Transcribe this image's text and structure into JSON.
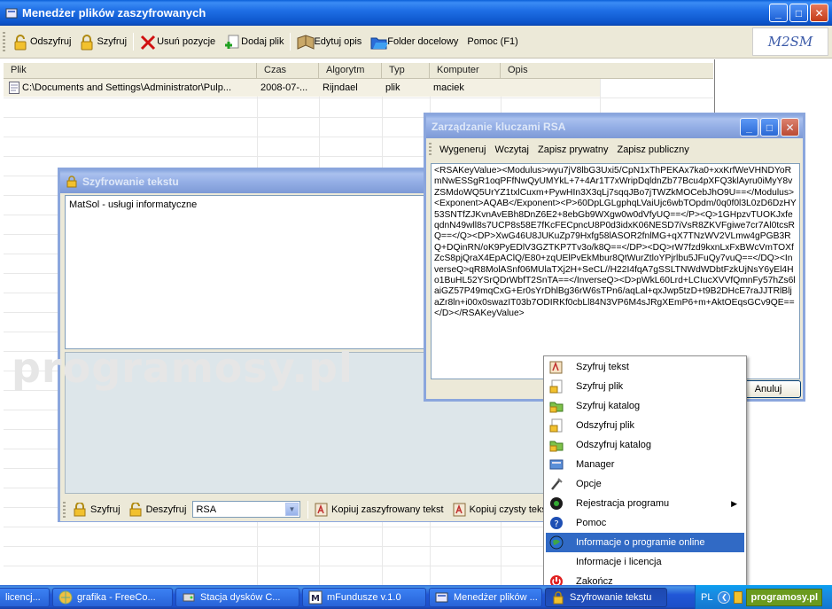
{
  "main_window": {
    "title": "Menedżer plików zaszyfrowanych",
    "toolbar": [
      {
        "label": "Odszyfruj",
        "icon": "padlock-open-icon"
      },
      {
        "label": "Szyfruj",
        "icon": "padlock-icon"
      },
      {
        "label": "Usuń pozycje",
        "icon": "red-x-icon"
      },
      {
        "label": "Dodaj plik",
        "icon": "add-file-icon"
      },
      {
        "label": "Edytuj opis",
        "icon": "edit-book-icon"
      },
      {
        "label": "Folder docelowy",
        "icon": "folder-icon"
      },
      {
        "label": "Pomoc (F1)",
        "icon": ""
      }
    ],
    "logo_text": "M2SM",
    "columns": [
      "Plik",
      "Czas",
      "Algorytm",
      "Typ",
      "Komputer",
      "Opis"
    ],
    "rows": [
      {
        "plik": "C:\\Documents and Settings\\Administrator\\Pulp...",
        "czas": "2008-07-...",
        "algorytm": "Rijndael",
        "typ": "plik",
        "komputer": "maciek",
        "opis": ""
      }
    ]
  },
  "text_window": {
    "title": "Szyfrowanie tekstu",
    "input_text": "MatSol - usługi informatyczne",
    "toolbar": {
      "encrypt": "Szyfruj",
      "decrypt": "Deszyfruj",
      "algorithm": "RSA",
      "copy_encrypted": "Kopiuj zaszyfrowany tekst",
      "copy_plain": "Kopiuj czysty teks"
    }
  },
  "rsa_window": {
    "title": "Zarządzanie kluczami RSA",
    "menu": [
      "Wygeneruj",
      "Wczytaj",
      "Zapisz prywatny",
      "Zapisz publiczny"
    ],
    "key_text": "<RSAKeyValue><Modulus>wyu7jV8lbG3Uxi5/CpN1xThPEKAx7ka0+xxKrfWeVHNDYoRmNwESSgR1oqPFfNwQyUMYkL+7+4Ar1T7xWripDqldnZb77Bcu4pXFQ3klAyru0iMyY8vZSMdoWQ5UrYZ1txlCuxm+PywHIn3X3qLj7sqqJBo7jTWZkMOCebJhO9U==</Modulus><Exponent>AQAB</Exponent><P>60DpLGLgphqLVaiUjc6wbTOpdm/0q0f0l3L0zD6DzHY53SNTfZJKvnAvEBh8DnZ6E2+8ebGb9WXgw0w0dVfyUQ==</P><Q>1GHpzvTUOKJxfeqdnN49wll8s7UCP8s58E7fKcFECpncU8P0d3idxK06NESD7iVsR8ZKVFgiwe7cr7Al0tcsRQ==</Q><DP>XwG46U8JUKuZp79Hxfg58lASOR2fnlMG+qX7TNzWV2VLmw4gPGB3RQ+DQinRN/oK9PyEDlV3GZTKP7Tv3o/k8Q==</DP><DQ>rW7fzd9kxnLxFxBWcVmTOXfZcS8pjQraX4EpAClQ/E80+zqUElPvEkMbur8QtWurZtloYPjrlbu5JFuQy7vuQ==</DQ><InverseQ>qR8MolASnf06MUlaTXj2H+SeCL//H22I4fqA7gSSLTNWdWDbtFzkUjNsY6yEl4Ho1BuHL52YSrQDrWbfT2SnTA==</InverseQ><D>pWkL60Lrd+LCIucXVVfQmnFy57hZs6laiGZ57P49mqCxG+Er0sYrDhlBg36rW6sTPn6/aqLal+qxJwp5tzD+t9B2DHcE7raJJTRlBljaZr8ln+i00x0swazIT03b7ODIRKf0cbLl84N3VP6M4sJRgXEmP6+m+AktOEqsGCv9QE==</D></RSAKeyValue>",
    "cancel_label": "Anuluj"
  },
  "context_menu": {
    "items": [
      {
        "label": "Szyfruj tekst",
        "icon": "encrypt-text-icon",
        "selected": false,
        "submenu": false
      },
      {
        "label": "Szyfruj plik",
        "icon": "encrypt-file-icon",
        "selected": false,
        "submenu": false
      },
      {
        "label": "Szyfruj katalog",
        "icon": "encrypt-folder-icon",
        "selected": false,
        "submenu": false
      },
      {
        "label": "Odszyfruj plik",
        "icon": "decrypt-file-icon",
        "selected": false,
        "submenu": false
      },
      {
        "label": "Odszyfruj katalog",
        "icon": "decrypt-folder-icon",
        "selected": false,
        "submenu": false
      },
      {
        "label": "Manager",
        "icon": "manager-icon",
        "selected": false,
        "submenu": false
      },
      {
        "label": "Opcje",
        "icon": "tools-icon",
        "selected": false,
        "submenu": false
      },
      {
        "label": "Rejestracja programu",
        "icon": "registration-icon",
        "selected": false,
        "submenu": true
      },
      {
        "label": "Pomoc",
        "icon": "help-icon",
        "selected": false,
        "submenu": false
      },
      {
        "label": "Informacje o programie online",
        "icon": "globe-icon",
        "selected": true,
        "submenu": false
      },
      {
        "label": "Informacje i licencja",
        "icon": "",
        "selected": false,
        "submenu": false
      },
      {
        "label": "Zakończ",
        "icon": "power-icon",
        "selected": false,
        "submenu": false
      }
    ]
  },
  "watermark": "programosy.pl",
  "taskbar": {
    "items": [
      {
        "label": "licencj...",
        "active": false
      },
      {
        "label": "grafika - FreeCo...",
        "active": false
      },
      {
        "label": "Stacja dysków C...",
        "active": false
      },
      {
        "label": "mFundusze v.1.0",
        "active": false
      },
      {
        "label": "Menedżer plików ...",
        "active": false
      },
      {
        "label": "Szyfrowanie tekstu",
        "active": true
      }
    ],
    "language": "PL",
    "tray_logo": "programosy.pl"
  },
  "colors": {
    "titlebar_active": "#0b53c9",
    "window_face": "#ece9d8",
    "selection": "#316ac5",
    "text_window_panel": "#dde6ea"
  }
}
